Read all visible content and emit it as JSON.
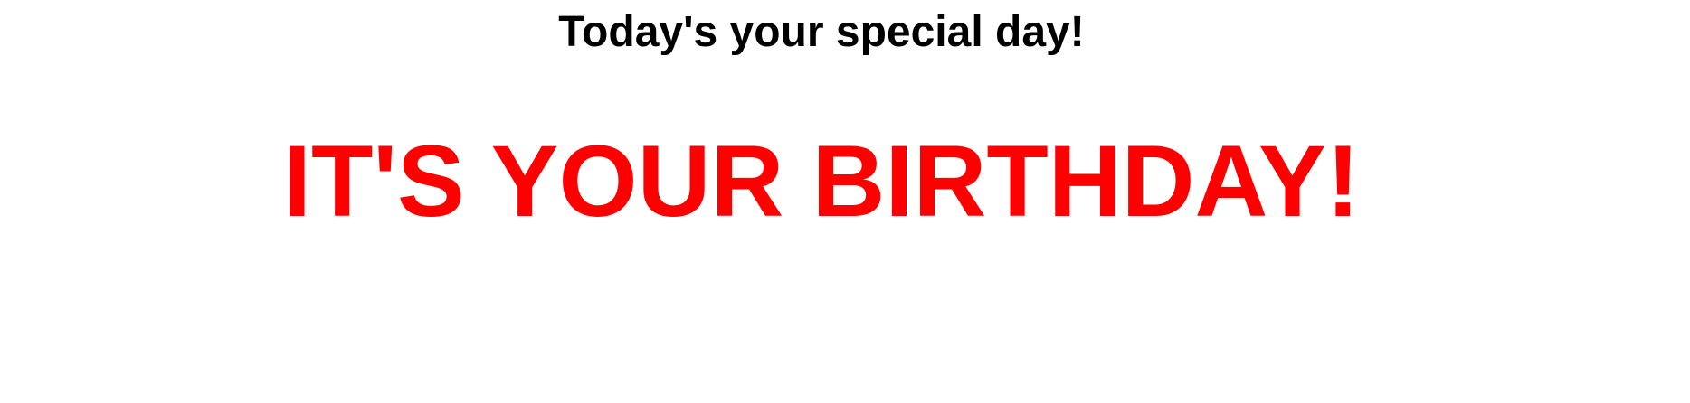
{
  "subtitle": "Today's your special day!",
  "headline": "IT'S YOUR BIRTHDAY!",
  "colors": {
    "subtitle": "#000000",
    "headline": "#ff0000",
    "background": "#ffffff"
  }
}
